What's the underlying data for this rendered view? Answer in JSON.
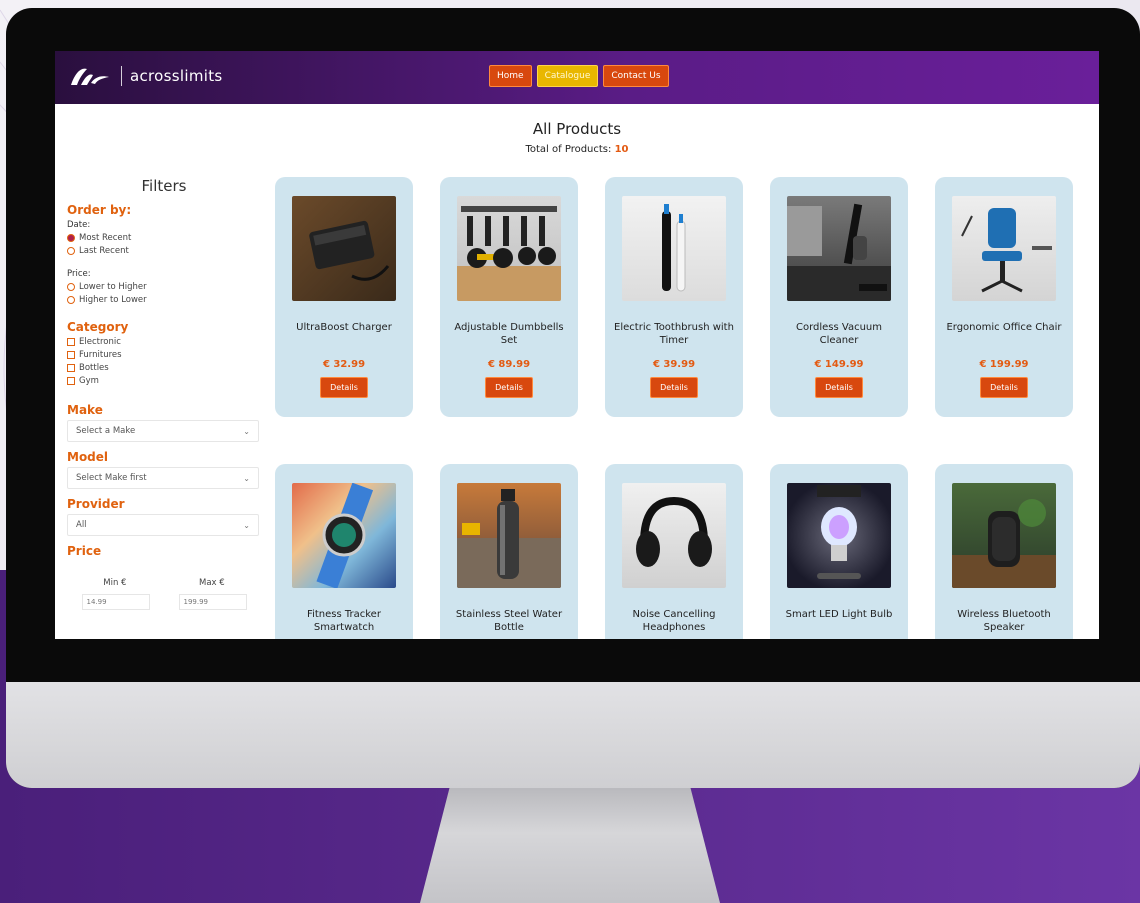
{
  "header": {
    "logo_text": "acrosslimits",
    "nav": [
      {
        "label": "Home",
        "active": false
      },
      {
        "label": "Catalogue",
        "active": true
      },
      {
        "label": "Contact Us",
        "active": false
      }
    ]
  },
  "main": {
    "title": "All Products",
    "total_label": "Total of Products:",
    "total_count": "10"
  },
  "filters": {
    "title": "Filters",
    "order_by": {
      "heading": "Order by:",
      "date_label": "Date:",
      "date_options": [
        {
          "label": "Most Recent",
          "checked": true
        },
        {
          "label": "Last Recent",
          "checked": false
        }
      ],
      "price_label": "Price:",
      "price_options": [
        {
          "label": "Lower to Higher",
          "checked": false
        },
        {
          "label": "Higher to Lower",
          "checked": false
        }
      ]
    },
    "category": {
      "heading": "Category",
      "options": [
        "Electronic",
        "Furnitures",
        "Bottles",
        "Gym"
      ]
    },
    "make": {
      "heading": "Make",
      "value": "Select a Make"
    },
    "model": {
      "heading": "Model",
      "value": "Select Make first"
    },
    "provider": {
      "heading": "Provider",
      "value": "All"
    },
    "price": {
      "heading": "Price",
      "min_label": "Min €",
      "max_label": "Max €",
      "min_value": "14.99",
      "max_value": "199.99"
    }
  },
  "products": [
    {
      "name": "UltraBoost Charger",
      "price": "€ 32.99",
      "details": "Details",
      "icon": "power-bank"
    },
    {
      "name": "Adjustable Dumbbells Set",
      "price": "€ 89.99",
      "details": "Details",
      "icon": "dumbbells"
    },
    {
      "name": "Electric Toothbrush with Timer",
      "price": "€ 39.99",
      "details": "Details",
      "icon": "toothbrush"
    },
    {
      "name": "Cordless Vacuum Cleaner",
      "price": "€ 149.99",
      "details": "Details",
      "icon": "vacuum"
    },
    {
      "name": "Ergonomic Office Chair",
      "price": "€ 199.99",
      "details": "Details",
      "icon": "office-chair"
    },
    {
      "name": "Fitness Tracker Smartwatch",
      "icon": "smartwatch"
    },
    {
      "name": "Stainless Steel Water Bottle",
      "icon": "water-bottle"
    },
    {
      "name": "Noise Cancelling Headphones",
      "icon": "headphones"
    },
    {
      "name": "Smart LED Light Bulb",
      "icon": "light-bulb"
    },
    {
      "name": "Wireless Bluetooth Speaker",
      "icon": "speaker"
    }
  ]
}
